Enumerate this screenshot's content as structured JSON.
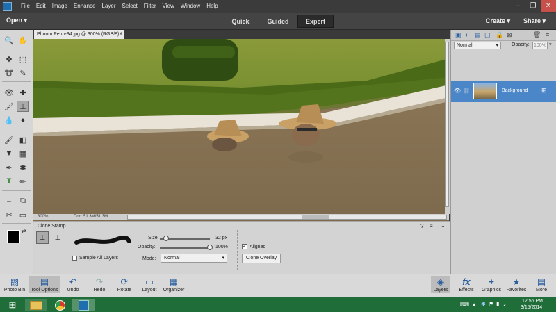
{
  "menu": [
    "File",
    "Edit",
    "Image",
    "Enhance",
    "Layer",
    "Select",
    "Filter",
    "View",
    "Window",
    "Help"
  ],
  "window_controls": {
    "minimize": "–",
    "restore": "❐",
    "close": "✕"
  },
  "modebar": {
    "open": "Open",
    "modes": [
      "Quick",
      "Guided",
      "Expert"
    ],
    "active_mode": "Expert",
    "create": "Create",
    "share": "Share"
  },
  "document": {
    "tab_title": "Phnom Penh-34.jpg @ 300% (RGB/8) *",
    "close": "×"
  },
  "status": {
    "zoom": "300%",
    "doc": "Doc: 51.3M/51.3M"
  },
  "tool_options": {
    "tool_name": "Clone Stamp",
    "size_label": "Size:",
    "size_value": "32 px",
    "size_level": 0.12,
    "opacity_label": "Opacity:",
    "opacity_value": "100%",
    "opacity_level": 1.0,
    "mode_label": "Mode:",
    "mode_value": "Normal",
    "sample_all_layers": "Sample All Layers",
    "aligned": "Aligned",
    "aligned_checked": true,
    "clone_overlay": "Clone Overlay"
  },
  "layers": {
    "blend_mode": "Normal",
    "opacity_label": "Opacity:",
    "opacity_value": "100%",
    "layer_name": "Background"
  },
  "bottombar": {
    "left": [
      {
        "label": "Photo Bin",
        "icon": "photo-bin-icon"
      },
      {
        "label": "Tool Options",
        "icon": "tool-options-icon"
      },
      {
        "label": "Undo",
        "icon": "undo-icon"
      },
      {
        "label": "Redo",
        "icon": "redo-icon"
      },
      {
        "label": "Rotate",
        "icon": "rotate-icon"
      },
      {
        "label": "Layout",
        "icon": "layout-icon"
      },
      {
        "label": "Organizer",
        "icon": "organizer-icon"
      }
    ],
    "right": [
      {
        "label": "Layers",
        "icon": "layers-icon"
      },
      {
        "label": "Effects",
        "icon": "effects-icon"
      },
      {
        "label": "Graphics",
        "icon": "graphics-icon"
      },
      {
        "label": "Favorites",
        "icon": "favorites-icon"
      },
      {
        "label": "More",
        "icon": "more-icon"
      }
    ]
  },
  "taskbar": {
    "time": "12:56 PM",
    "date": "3/15/2014"
  },
  "colors": {
    "accent": "#4b86c8",
    "taskbar": "#1f6e3a"
  }
}
